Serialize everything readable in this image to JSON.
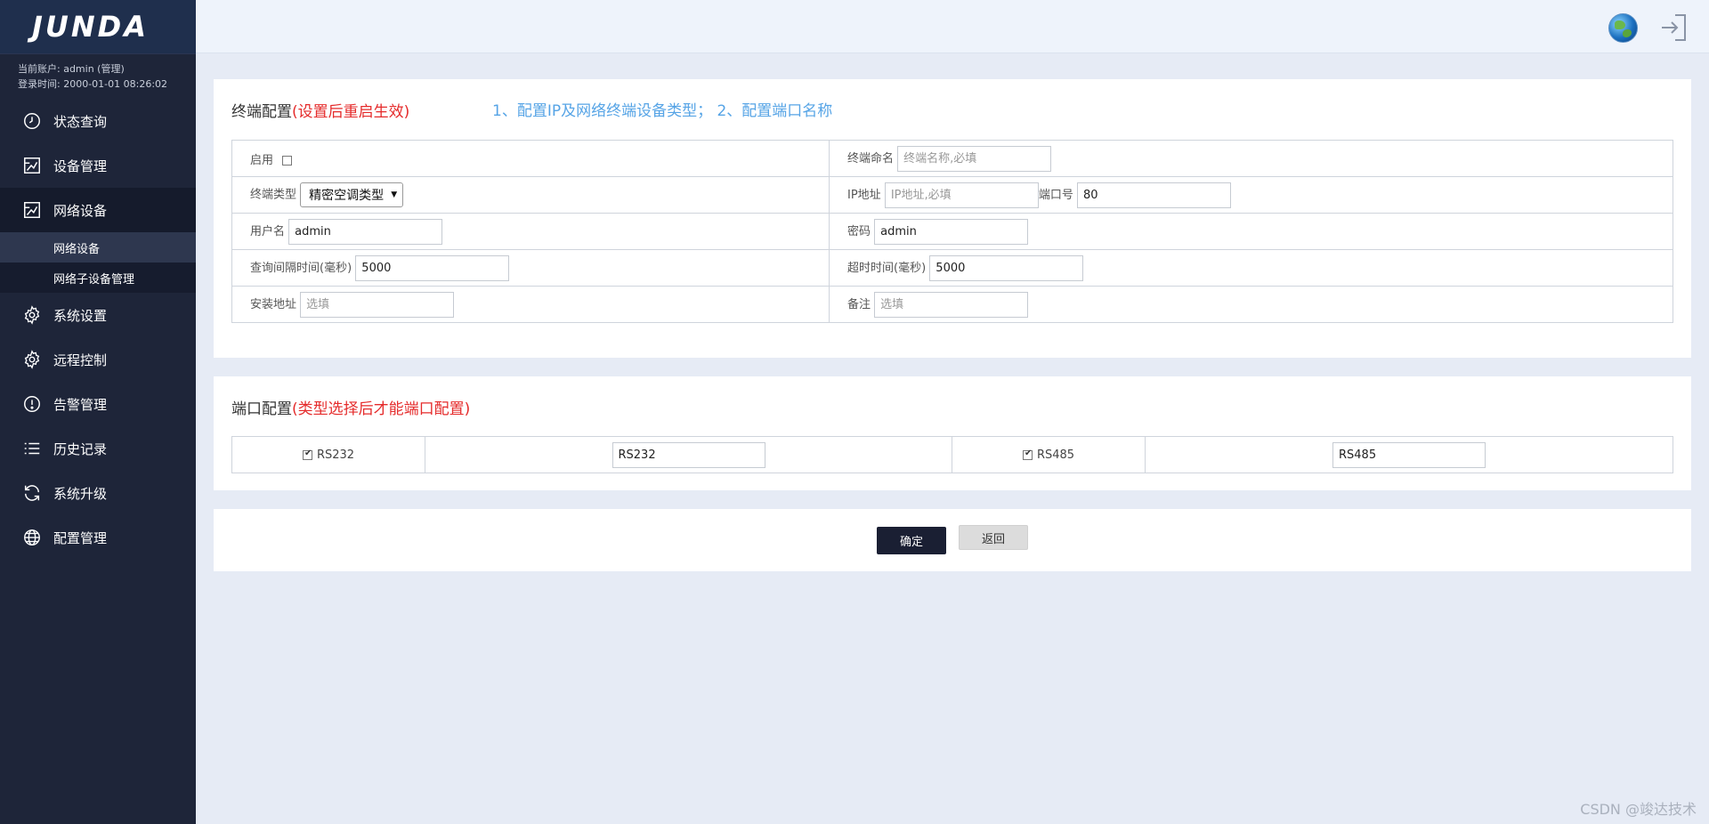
{
  "brand": {
    "logo_text": "JUNDA"
  },
  "account": {
    "user_line": "当前账户: admin (管理)",
    "login_line": "登录时间: 2000-01-01 08:26:02"
  },
  "sidebar": {
    "items": [
      {
        "label": "状态查询",
        "icon": "clock-icon"
      },
      {
        "label": "设备管理",
        "icon": "device-icon"
      },
      {
        "label": "网络设备",
        "icon": "network-device-icon"
      },
      {
        "label": "系统设置",
        "icon": "gear-icon"
      },
      {
        "label": "远程控制",
        "icon": "remote-gear-icon"
      },
      {
        "label": "告警管理",
        "icon": "alert-icon"
      },
      {
        "label": "历史记录",
        "icon": "list-icon"
      },
      {
        "label": "系统升级",
        "icon": "refresh-icon"
      },
      {
        "label": "配置管理",
        "icon": "globe-config-icon"
      }
    ],
    "sub_items": [
      {
        "label": "网络设备"
      },
      {
        "label": "网络子设备管理"
      }
    ]
  },
  "topbar": {
    "icons": [
      "globe-icon",
      "logout-icon"
    ]
  },
  "terminal": {
    "title": "终端配置",
    "title_note": "(设置后重启生效)",
    "tip": "1、配置IP及网络终端设备类型； 2、配置端口名称",
    "enable_label": "启用",
    "name_label": "终端命名",
    "name_placeholder": "终端名称,必填",
    "type_label": "终端类型",
    "type_value": "精密空调类型",
    "ip_label": "IP地址",
    "ip_placeholder": "IP地址,必填",
    "port_label": "端口号",
    "port_value": "80",
    "user_label": "用户名",
    "user_value": "admin",
    "pwd_label": "密码",
    "pwd_value": "admin",
    "interval_label": "查询间隔时间(毫秒)",
    "interval_value": "5000",
    "timeout_label": "超时时间(毫秒)",
    "timeout_value": "5000",
    "addr_label": "安装地址",
    "addr_placeholder": "选填",
    "remark_label": "备注",
    "remark_placeholder": "选填"
  },
  "ports": {
    "title": "端口配置",
    "title_note": "(类型选择后才能端口配置)",
    "items": [
      {
        "label": "RS232",
        "value": "RS232",
        "checked": true
      },
      {
        "label": "RS485",
        "value": "RS485",
        "checked": true
      }
    ]
  },
  "actions": {
    "ok_label": "确定",
    "back_label": "返回"
  },
  "watermark": "CSDN @竣达技术"
}
